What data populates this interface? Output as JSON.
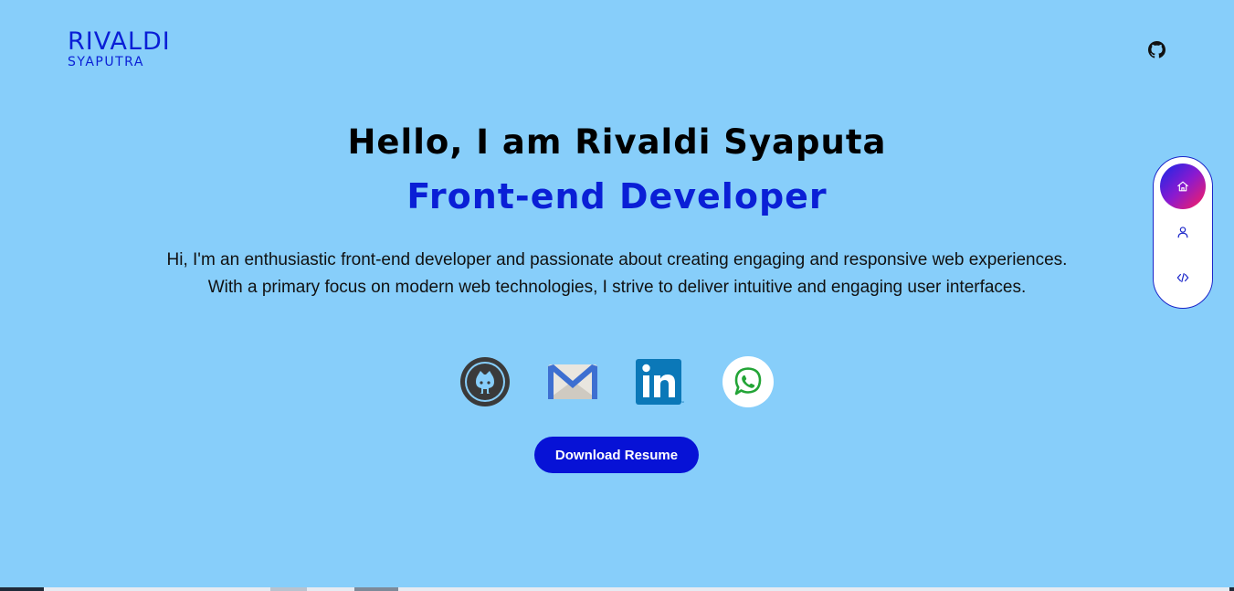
{
  "header": {
    "logo_main": "RIVALDI",
    "logo_sub": "SYAPUTRA",
    "github_icon": "github-icon"
  },
  "hero": {
    "title": "Hello, I am Rivaldi Syaputa",
    "role": "Front-end Developer",
    "description": "Hi, I'm an enthusiastic front-end developer and passionate about creating engaging and responsive web experiences. With a primary focus on modern web technologies, I strive to deliver intuitive and engaging user interfaces."
  },
  "socials": [
    {
      "name": "github",
      "icon": "github-icon"
    },
    {
      "name": "email",
      "icon": "mail-icon"
    },
    {
      "name": "linkedin",
      "icon": "linkedin-icon"
    },
    {
      "name": "whatsapp",
      "icon": "whatsapp-icon"
    }
  ],
  "actions": {
    "download_label": "Download Resume"
  },
  "side_nav": {
    "items": [
      {
        "name": "home",
        "icon": "home-icon",
        "active": true
      },
      {
        "name": "about",
        "icon": "user-icon",
        "active": false
      },
      {
        "name": "projects",
        "icon": "code-icon",
        "active": false
      }
    ]
  },
  "colors": {
    "background": "#87CEFA",
    "accent": "#0a1fd6",
    "button": "#0712d6"
  }
}
